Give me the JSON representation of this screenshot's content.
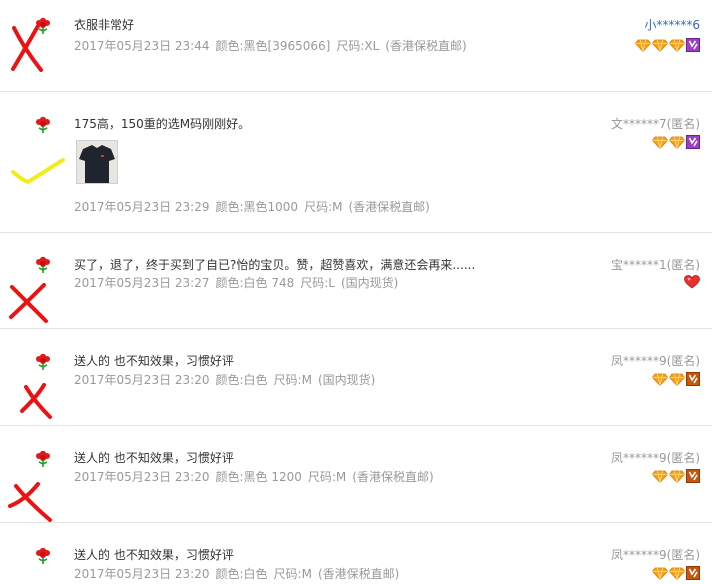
{
  "reviews": [
    {
      "text": "衣服非常好",
      "date": "2017年05月23日 23:44",
      "color": "颜色:黑色[3965066]",
      "size": "尺码:XL",
      "shipping": "(香港保税直邮)",
      "user": "小******6"
    },
    {
      "text": "175高，150重的选M码刚刚好。",
      "date": "2017年05月23日 23:29",
      "color": "颜色:黑色1000",
      "size": "尺码:M",
      "shipping": "(香港保税直邮)",
      "user": "文******7(匿名)"
    },
    {
      "text": "买了，退了，终于买到了自已?怡的宝贝。赞，超赞喜欢，满意还会再来......",
      "date": "2017年05月23日 23:27",
      "color": "颜色:白色 748",
      "size": "尺码:L",
      "shipping": "(国内现货)",
      "user": "宝******1(匿名)"
    },
    {
      "text": "送人的 也不知效果，习惯好评",
      "date": "2017年05月23日 23:20",
      "color": "颜色:白色",
      "size": "尺码:M",
      "shipping": "(国内现货)",
      "user": "凤******9(匿名)"
    },
    {
      "text": "送人的 也不知效果，习惯好评",
      "date": "2017年05月23日 23:20",
      "color": "颜色:黑色 1200",
      "size": "尺码:M",
      "shipping": "(香港保税直邮)",
      "user": "凤******9(匿名)"
    },
    {
      "text": "送人的 也不知效果，习惯好评",
      "date": "2017年05月23日 23:20",
      "color": "颜色:白色",
      "size": "尺码:M",
      "shipping": "(香港保税直邮)",
      "user": "凤******9(匿名)"
    }
  ],
  "icons": {
    "flower": "red-flower-icon",
    "diamond": "orange-diamond-icon",
    "vip": "purple-vip-badge-icon",
    "crown": "orange-crown-badge-icon",
    "heart": "red-heart-icon",
    "cross": "red-hand-drawn-cross",
    "check": "yellow-hand-drawn-check"
  },
  "colors": {
    "text": "#333333",
    "meta": "#999999",
    "user_link": "#3366cc",
    "mark_red": "#ee1111",
    "mark_yellow": "#f2ec1c"
  }
}
